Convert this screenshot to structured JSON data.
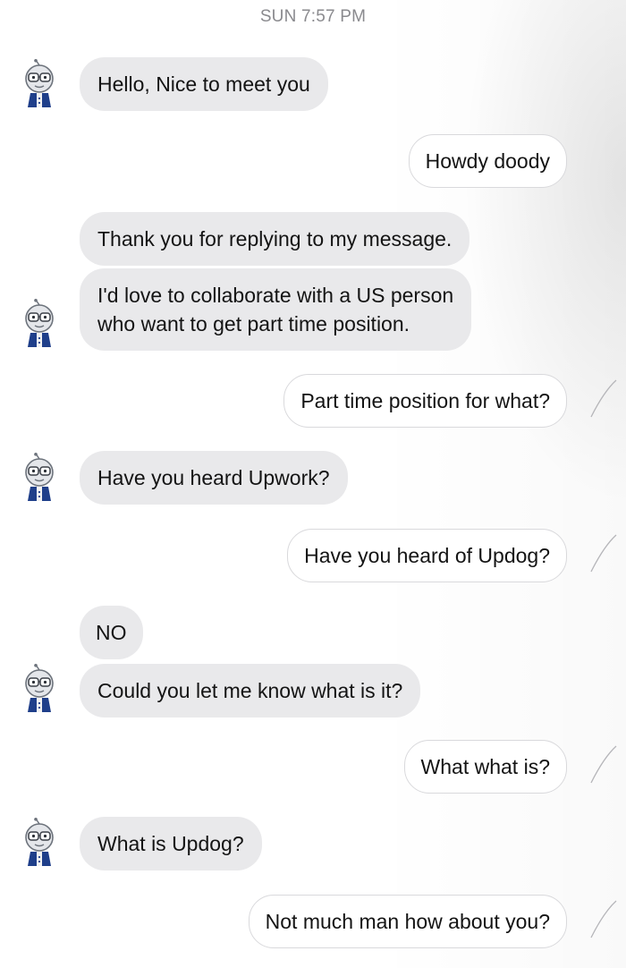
{
  "conversation": {
    "timestamp": "SUN 7:57 PM",
    "messages": [
      {
        "sender": "them",
        "text": "Hello, Nice to meet you"
      },
      {
        "sender": "me",
        "text": "Howdy doody"
      },
      {
        "sender": "them",
        "text": "Thank you for replying to my message."
      },
      {
        "sender": "them",
        "lines": [
          "I'd love to collaborate with a US person",
          "who want to get part time position."
        ]
      },
      {
        "sender": "me",
        "text": "Part time position for what?"
      },
      {
        "sender": "them",
        "text": "Have you heard Upwork?"
      },
      {
        "sender": "me",
        "text": "Have you heard of Updog?"
      },
      {
        "sender": "them",
        "text": "NO"
      },
      {
        "sender": "them",
        "text": "Could you let me know what is it?"
      },
      {
        "sender": "me",
        "text": "What what is?"
      },
      {
        "sender": "them",
        "text": "What is Updog?"
      },
      {
        "sender": "me",
        "text": "Not much man how about you?"
      }
    ]
  },
  "icons": {
    "contact_avatar": "robot-avatar-icon",
    "read_receipt": "read-receipt-icon"
  },
  "colors": {
    "incoming_bubble": "#e9e9eb",
    "outgoing_bubble": "#ffffff",
    "outgoing_border": "#d9d9dc",
    "timestamp": "#8a8a8e"
  }
}
